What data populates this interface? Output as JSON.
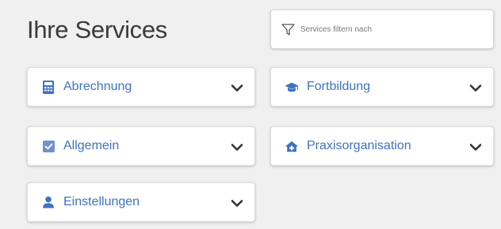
{
  "page": {
    "title": "Ihre Services"
  },
  "filter": {
    "placeholder": "Services filtern nach",
    "icon": "filter-icon"
  },
  "colors": {
    "accent": "#3d73c2",
    "background": "#f0f0f0",
    "card": "#ffffff",
    "chevron": "#333333"
  },
  "services": [
    {
      "label": "Abrechnung",
      "icon": "calculator-icon",
      "expanded": false
    },
    {
      "label": "Fortbildung",
      "icon": "graduation-cap-icon",
      "expanded": false
    },
    {
      "label": "Allgemein",
      "icon": "checkbox-icon",
      "expanded": false
    },
    {
      "label": "Praxisorganisation",
      "icon": "house-plus-icon",
      "expanded": false
    },
    {
      "label": "Einstellungen",
      "icon": "user-icon",
      "expanded": false
    }
  ]
}
